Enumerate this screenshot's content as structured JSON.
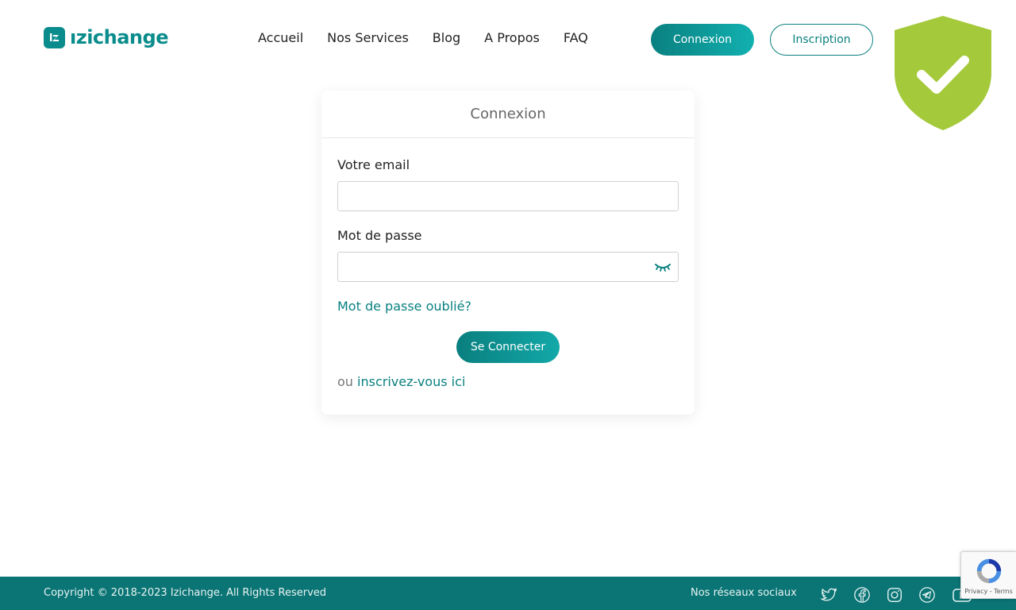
{
  "brand": {
    "name": "ızichange",
    "logo_icon": "izichange-logo-mark",
    "accent": "#0a8080"
  },
  "nav": {
    "items": [
      {
        "label": "Accueil"
      },
      {
        "label": "Nos Services"
      },
      {
        "label": "Blog"
      },
      {
        "label": "A Propos"
      },
      {
        "label": "FAQ"
      }
    ]
  },
  "header": {
    "login_label": "Connexion",
    "signup_label": "Inscription"
  },
  "security_badge": {
    "icon": "shield-check-icon",
    "color": "#a4c93a"
  },
  "login_card": {
    "title": "Connexion",
    "email_label": "Votre email",
    "email_value": "",
    "password_label": "Mot de passe",
    "password_value": "",
    "toggle_icon": "eye-closed-icon",
    "forgot_label": "Mot de passe oublié?",
    "submit_label": "Se Connecter",
    "or_text": "ou",
    "register_link": "inscrivez-vous ici"
  },
  "footer": {
    "copyright": "Copyright © 2018-2023 Izichange. All Rights Reserved",
    "social_label": "Nos réseaux sociaux",
    "social_icons": [
      "twitter-icon",
      "facebook-icon",
      "instagram-icon",
      "telegram-icon",
      "youtube-icon"
    ]
  },
  "recaptcha": {
    "links": "Privacy - Terms"
  }
}
